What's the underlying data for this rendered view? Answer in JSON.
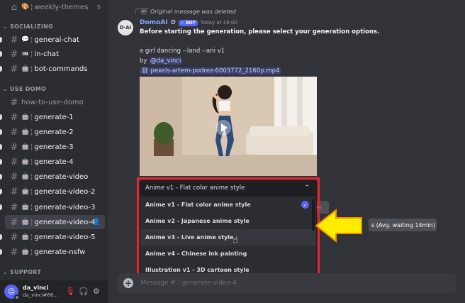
{
  "sidebar": {
    "top_channel": {
      "emoji": "🎨",
      "name": "weekly-themes",
      "count": "5"
    },
    "categories": {
      "socializing": "SOCIALIZING",
      "use_domo": "USE DOMO",
      "support": "SUPPORT"
    },
    "socializing_channels": [
      {
        "emoji": "💬",
        "name": "general-chat"
      },
      {
        "emoji": "IN",
        "name": "in-chat"
      },
      {
        "emoji": "🤖",
        "name": "bot-commands"
      }
    ],
    "domo_channels": [
      {
        "emoji": "",
        "name": "how-to-use-domo"
      },
      {
        "emoji": "🤖",
        "name": "generate-1"
      },
      {
        "emoji": "🤖",
        "name": "generate-2"
      },
      {
        "emoji": "🤖",
        "name": "generate-3"
      },
      {
        "emoji": "🤖",
        "name": "generate-4"
      },
      {
        "emoji": "🤖",
        "name": "generate-video"
      },
      {
        "emoji": "🤖",
        "name": "generate-video-2"
      },
      {
        "emoji": "🤖",
        "name": "generate-video-3"
      },
      {
        "emoji": "🤖",
        "name": "generate-video-4"
      },
      {
        "emoji": "🤖",
        "name": "generate-video-5"
      },
      {
        "emoji": "🤖",
        "name": "generate-nsfw"
      }
    ],
    "user": {
      "name": "da_vinci",
      "tag": "da_vinci#66..."
    }
  },
  "message": {
    "reply_text": "Original message was deleted",
    "bot_name": "DomoAI",
    "bot_badge": "BOT",
    "bot_avatar_text": "D·AI",
    "timestamp": "Today at 19:00",
    "headline": "Before starting the generation, please select your generation options.",
    "prompt": "a girl dancing --land --ani v1",
    "by_label": "by",
    "mention": "@da_vinci",
    "file": "pexels-artem-podrez-6003772_2160p.mp4"
  },
  "dropdown": {
    "selected": "Anime v1 - Flat color anime style",
    "options": [
      "Anime v1 - Flat color anime style",
      "Anime v2 - Japanese anime style",
      "Anime v3 - Live anime style",
      "Anime v4 - Chinese ink painting",
      "Illustration v1 - 3D cartoon style"
    ]
  },
  "buttons": {
    "partial_right": "re",
    "queue": "s (Avg. waiting 14min)"
  },
  "input": {
    "placeholder": "Message #  ¦ generate-video-4"
  },
  "colors": {
    "highlight": "#e8242f",
    "arrow": "#ffec00",
    "accent": "#5865f2"
  }
}
